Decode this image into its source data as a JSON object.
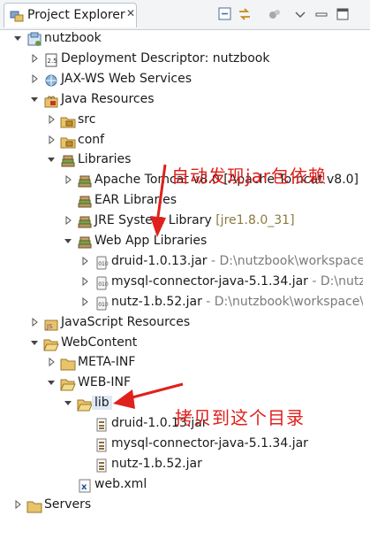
{
  "tab": {
    "title": "Project Explorer",
    "close": "✕"
  },
  "tree": [
    {
      "name": "project-nutzbook",
      "label": "nutzbook",
      "indent": 0,
      "tw": "down",
      "icon": "project"
    },
    {
      "name": "deployment-descriptor",
      "label": "Deployment Descriptor: nutzbook",
      "indent": 1,
      "tw": "right",
      "icon": "dd"
    },
    {
      "name": "jaxws-web-services",
      "label": "JAX-WS Web Services",
      "indent": 1,
      "tw": "right",
      "icon": "ws"
    },
    {
      "name": "java-resources",
      "label": "Java Resources",
      "indent": 1,
      "tw": "down",
      "icon": "javares"
    },
    {
      "name": "src-folder",
      "label": "src",
      "indent": 2,
      "tw": "right",
      "icon": "pkgfolder"
    },
    {
      "name": "conf-folder",
      "label": "conf",
      "indent": 2,
      "tw": "right",
      "icon": "pkgfolder"
    },
    {
      "name": "libraries",
      "label": "Libraries",
      "indent": 2,
      "tw": "down",
      "icon": "library"
    },
    {
      "name": "apache-tomcat-lib",
      "label": "Apache Tomcat v8.0 [Apache Tomcat v8.0]",
      "indent": 3,
      "tw": "right",
      "icon": "library"
    },
    {
      "name": "ear-libraries",
      "label": "EAR Libraries",
      "indent": 3,
      "tw": "none",
      "icon": "library"
    },
    {
      "name": "jre-system-library",
      "label": "JRE System Library",
      "deco": " [jre1.8.0_31]",
      "decoClass": "olive",
      "indent": 3,
      "tw": "right",
      "icon": "library"
    },
    {
      "name": "web-app-libraries",
      "label": "Web App Libraries",
      "indent": 3,
      "tw": "down",
      "icon": "library"
    },
    {
      "name": "druid-jar-ref",
      "label": "druid-1.0.13.jar",
      "deco": " - D:\\nutzbook\\workspace\\",
      "indent": 4,
      "tw": "right",
      "icon": "jar"
    },
    {
      "name": "mysql-jar-ref",
      "label": "mysql-connector-java-5.1.34.jar",
      "deco": " - D:\\nutzl",
      "indent": 4,
      "tw": "right",
      "icon": "jar"
    },
    {
      "name": "nutz-jar-ref",
      "label": "nutz-1.b.52.jar",
      "deco": " - D:\\nutzbook\\workspace\\",
      "indent": 4,
      "tw": "right",
      "icon": "jar"
    },
    {
      "name": "javascript-resources",
      "label": "JavaScript Resources",
      "indent": 1,
      "tw": "right",
      "icon": "jsres"
    },
    {
      "name": "webcontent-folder",
      "label": "WebContent",
      "indent": 1,
      "tw": "down",
      "icon": "folder-open"
    },
    {
      "name": "meta-inf-folder",
      "label": "META-INF",
      "indent": 2,
      "tw": "right",
      "icon": "folder"
    },
    {
      "name": "web-inf-folder",
      "label": "WEB-INF",
      "indent": 2,
      "tw": "down",
      "icon": "folder-open"
    },
    {
      "name": "lib-folder",
      "label": "lib",
      "indent": 3,
      "tw": "down",
      "icon": "folder-open",
      "selected": true
    },
    {
      "name": "druid-jar-file",
      "label": "druid-1.0.13.jar",
      "indent": 4,
      "tw": "none",
      "icon": "jarfile"
    },
    {
      "name": "mysql-jar-file",
      "label": "mysql-connector-java-5.1.34.jar",
      "indent": 4,
      "tw": "none",
      "icon": "jarfile"
    },
    {
      "name": "nutz-jar-file",
      "label": "nutz-1.b.52.jar",
      "indent": 4,
      "tw": "none",
      "icon": "jarfile"
    },
    {
      "name": "web-xml-file",
      "label": "web.xml",
      "indent": 3,
      "tw": "none",
      "icon": "xml"
    },
    {
      "name": "servers",
      "label": "Servers",
      "indent": 0,
      "tw": "right",
      "icon": "folder"
    }
  ],
  "annotations": {
    "auto_detect": "自动发现jar包依赖",
    "copy_here": "拷贝到这个目录"
  },
  "colors": {
    "annotation": "#e0201c",
    "selection": "#dfe8f6"
  }
}
